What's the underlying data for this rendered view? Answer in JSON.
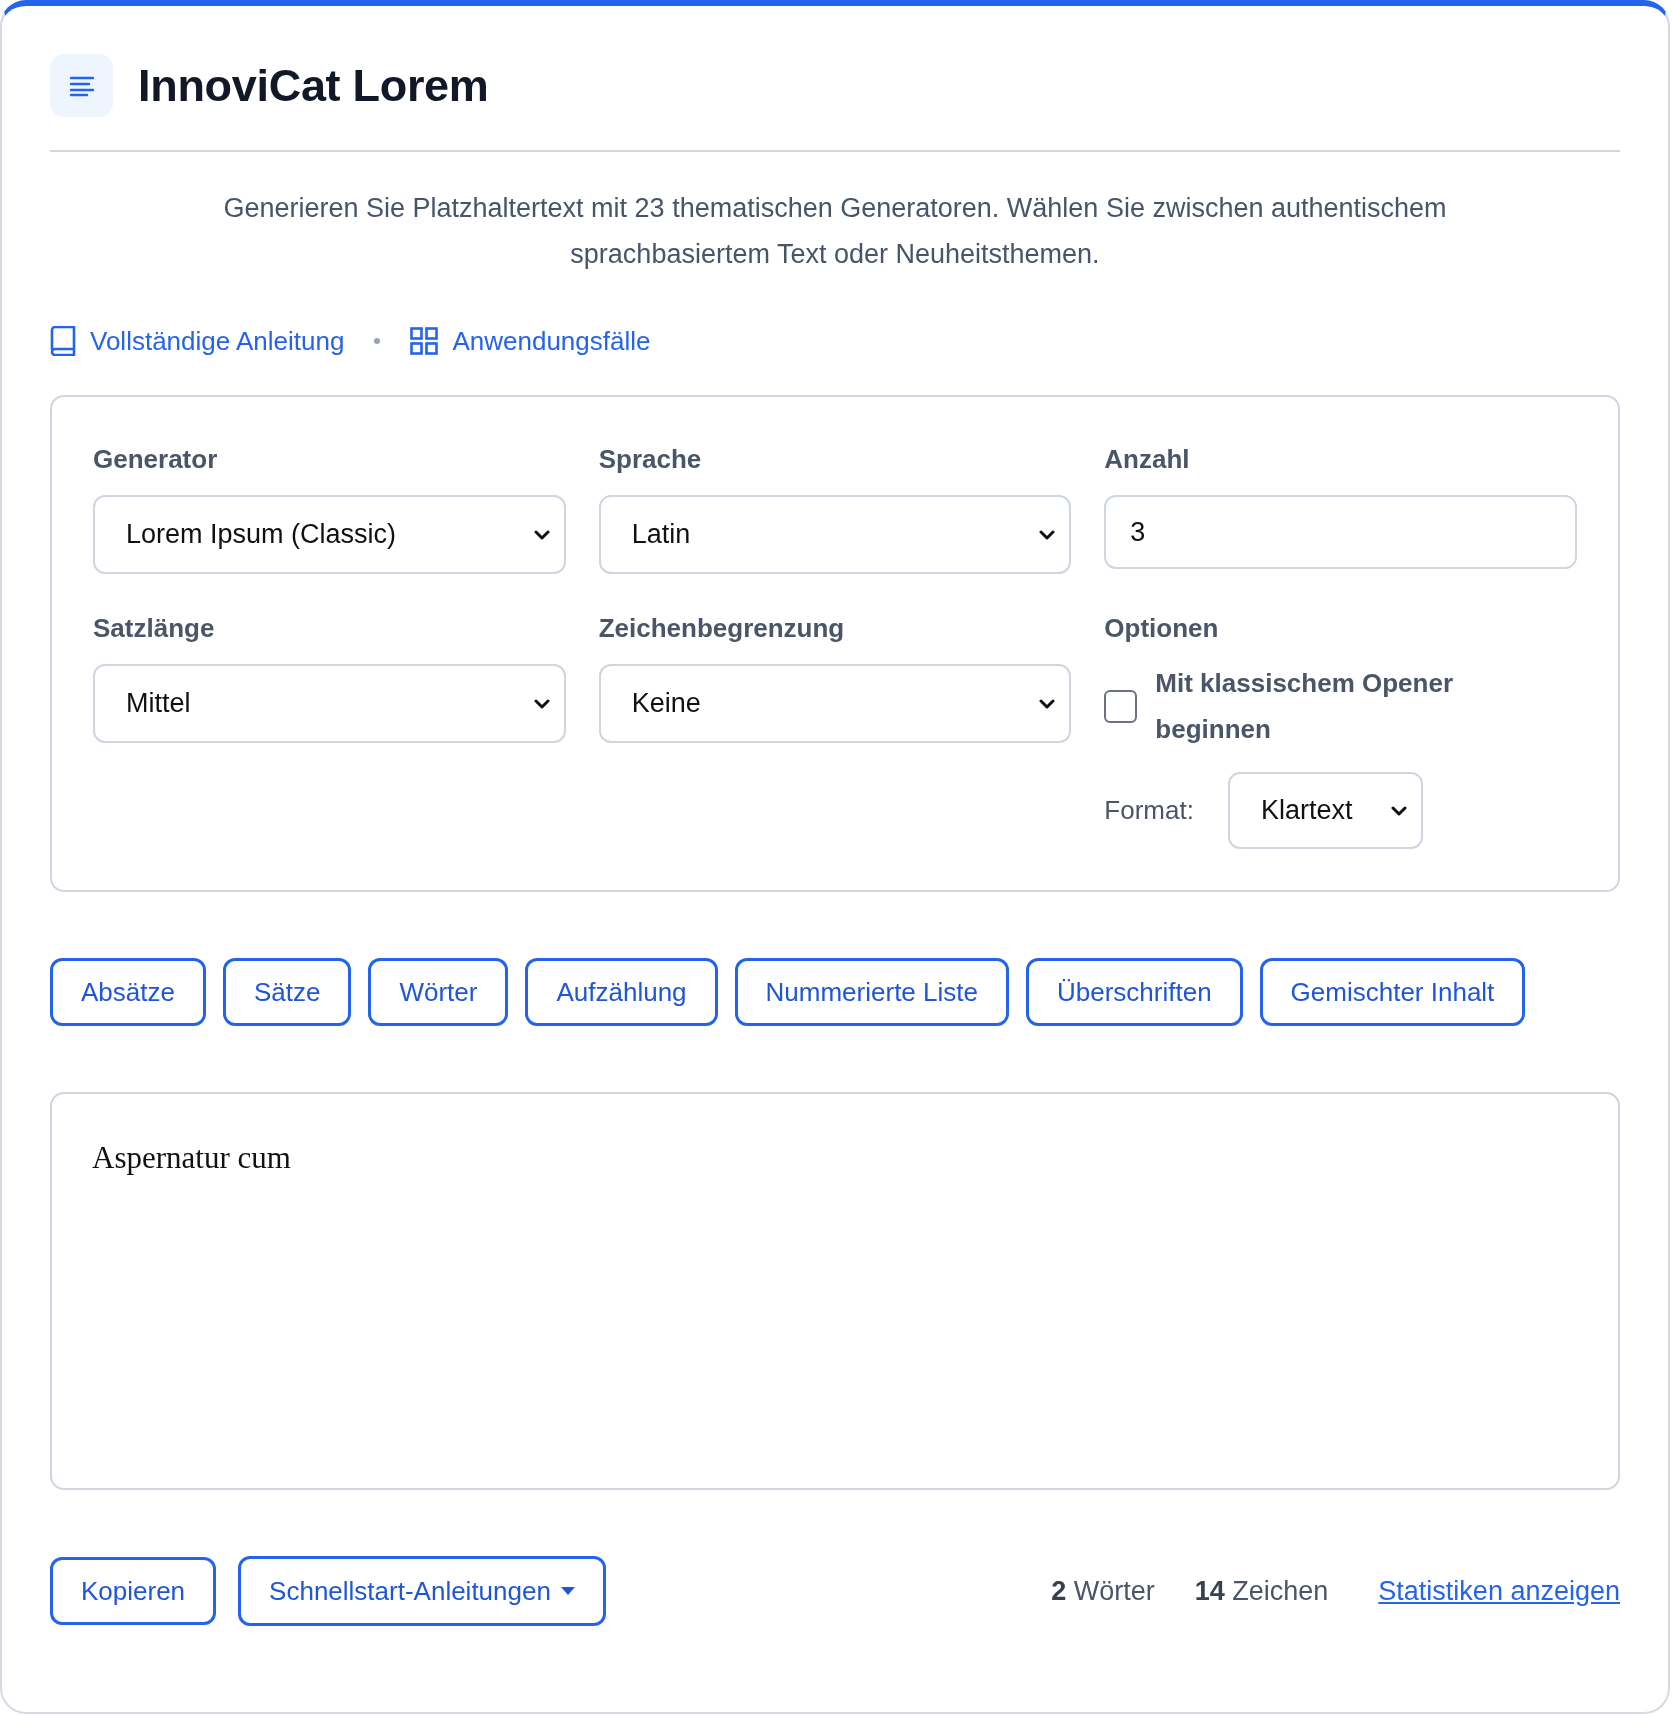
{
  "header": {
    "title": "InnoviCat Lorem"
  },
  "description": "Generieren Sie Platzhaltertext mit 23 thematischen Generatoren. Wählen Sie zwischen authentischem sprachbasiertem Text oder Neuheitsthemen.",
  "links": [
    {
      "label": "Vollständige Anleitung",
      "kind": "book"
    },
    {
      "label": "Anwendungsfälle",
      "kind": "grid"
    }
  ],
  "settings": {
    "fields": [
      {
        "label": "Generator",
        "kind": "select",
        "value": "Lorem Ipsum (Classic)"
      },
      {
        "label": "Sprache",
        "kind": "select",
        "value": "Latin"
      },
      {
        "label": "Anzahl",
        "kind": "number",
        "value": "3"
      },
      {
        "label": "Satzlänge",
        "kind": "select",
        "value": "Mittel"
      },
      {
        "label": "Zeichenbegrenzung",
        "kind": "select",
        "value": "Keine"
      }
    ],
    "options": {
      "label": "Optionen",
      "checkbox": {
        "label": "Mit klassischem Opener beginnen",
        "checked": false
      },
      "format": {
        "label": "Format:",
        "value": "Klartext"
      }
    }
  },
  "generate_buttons": [
    "Absätze",
    "Sätze",
    "Wörter",
    "Aufzählung",
    "Nummerierte Liste",
    "Überschriften",
    "Gemischter Inhalt"
  ],
  "output": {
    "text": "Aspernatur cum"
  },
  "footer": {
    "buttons": [
      {
        "label": "Kopieren",
        "kind": "plain"
      },
      {
        "label": "Schnellstart-Anleitungen",
        "kind": "dropdown"
      }
    ],
    "stats": [
      "**2** Wörter",
      "**14** Zeichen"
    ],
    "link": "Statistiken anzeigen"
  }
}
